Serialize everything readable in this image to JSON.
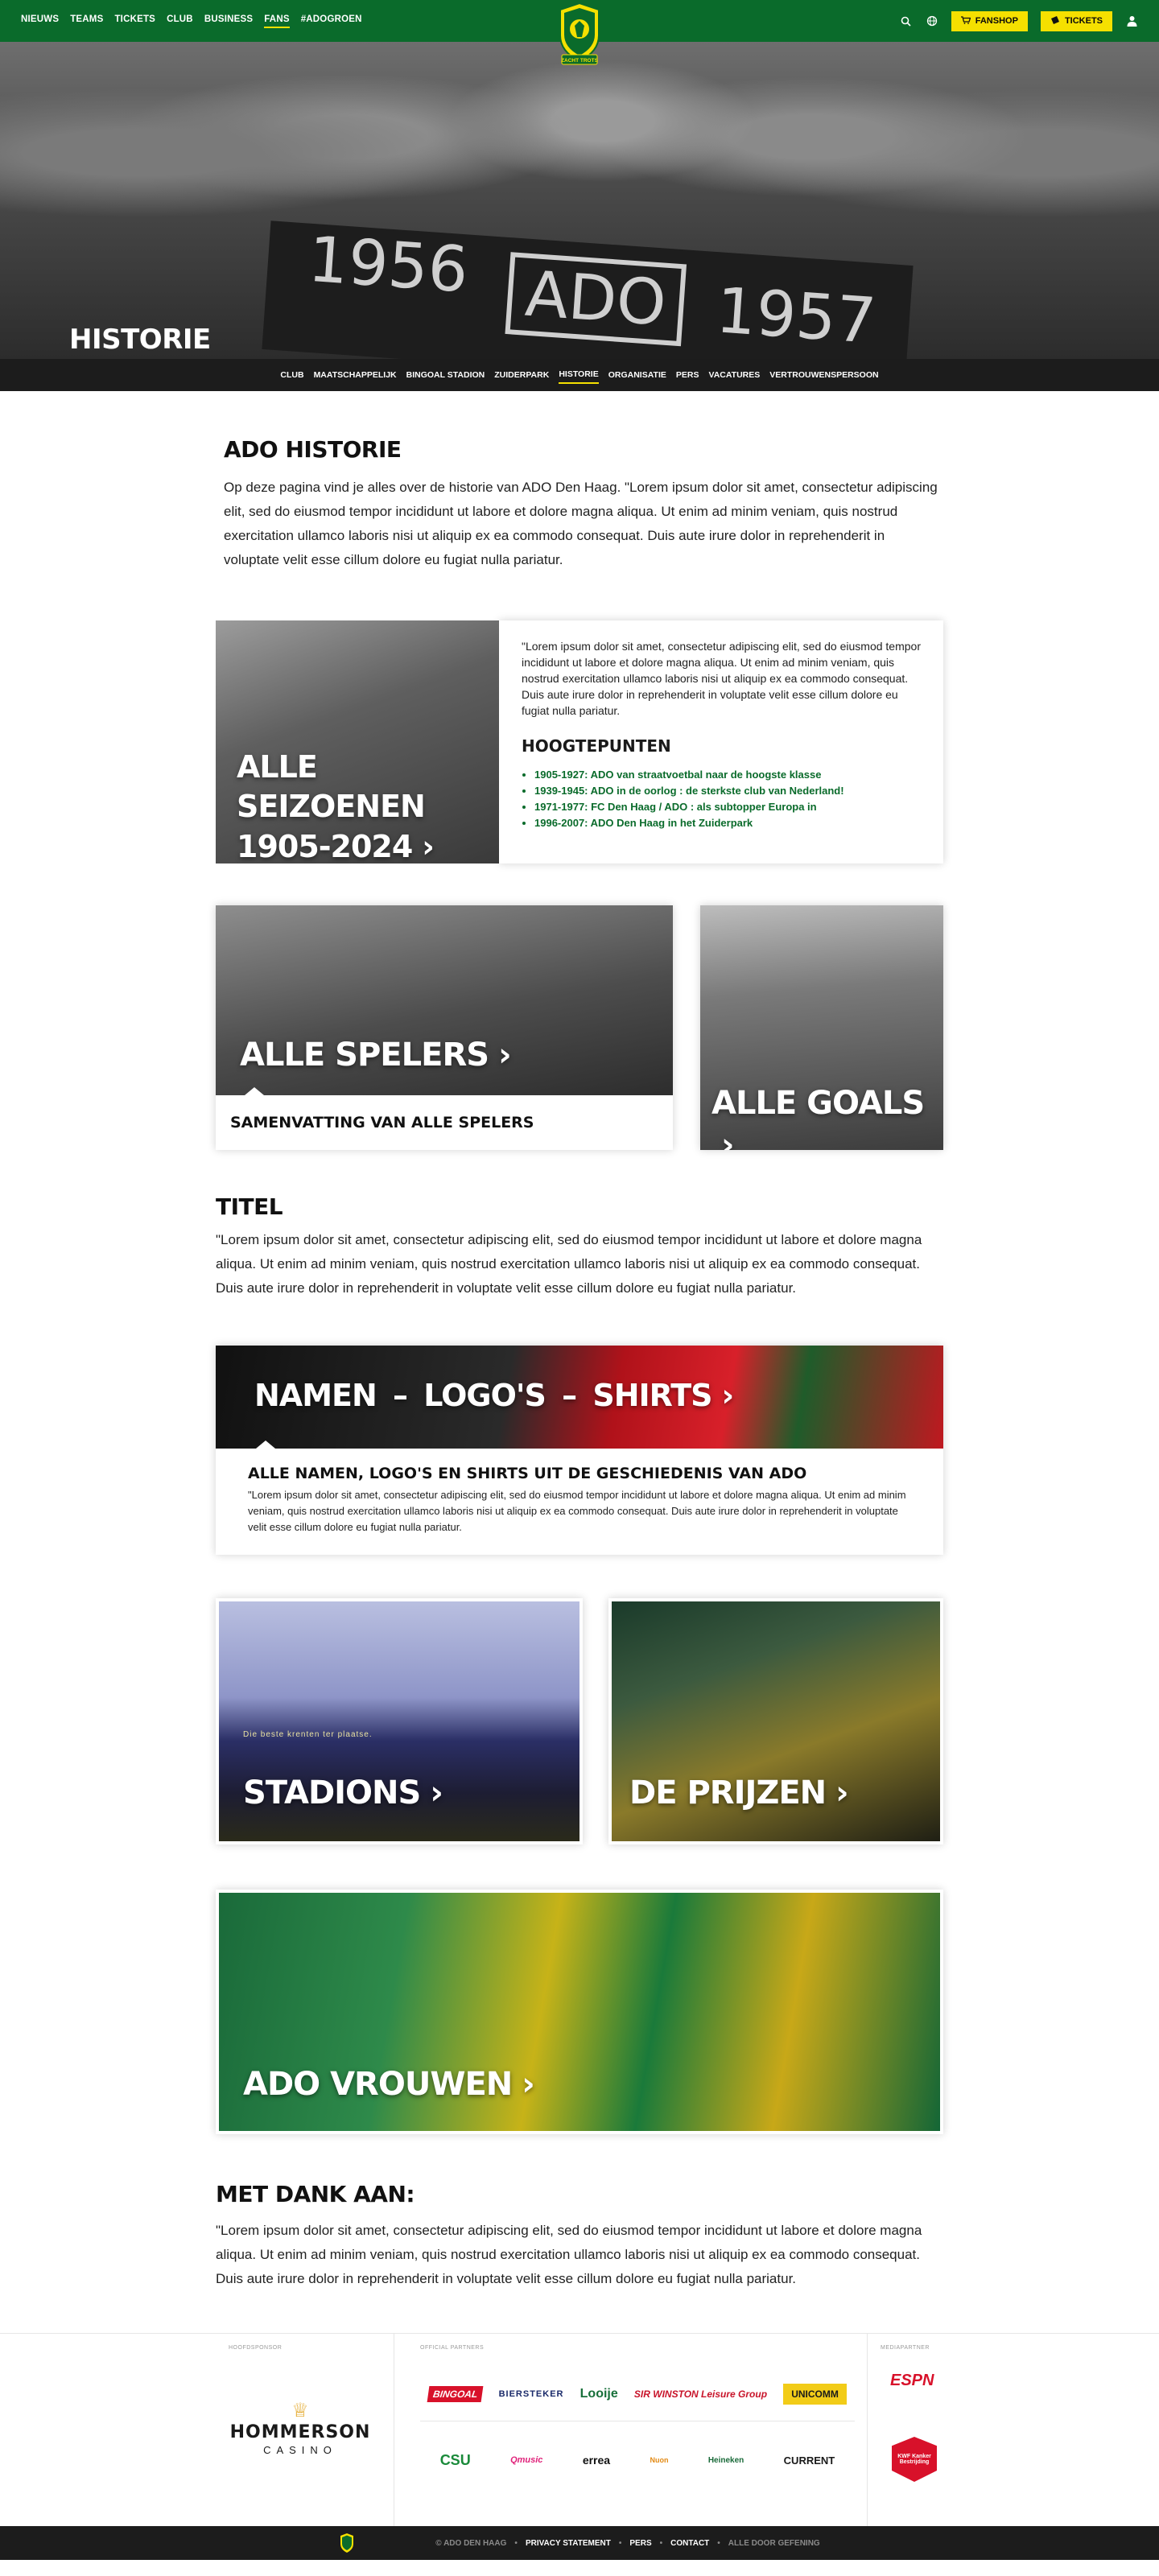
{
  "nav": {
    "items": [
      {
        "label": "NIEUWS",
        "active": false
      },
      {
        "label": "TEAMS",
        "active": false
      },
      {
        "label": "TICKETS",
        "active": false
      },
      {
        "label": "CLUB",
        "active": false
      },
      {
        "label": "BUSINESS",
        "active": false
      },
      {
        "label": "FANS",
        "active": true
      },
      {
        "label": "#ADOGROEN",
        "active": false
      }
    ],
    "crest_text": "ZACHT TROTS",
    "fanshop": "FANSHOP",
    "tickets": "TICKETS",
    "icons": [
      "search-icon",
      "globe-icon",
      "user-icon"
    ],
    "brand_green": "#0a6b2b",
    "accent_yellow": "#f5e000"
  },
  "hero": {
    "title": "HISTORIE",
    "banner_left": "1956",
    "banner_mid": "ADO",
    "banner_right": "1957"
  },
  "subnav": {
    "items": [
      {
        "label": "CLUB",
        "active": false
      },
      {
        "label": "MAATSCHAPPELIJK",
        "active": false
      },
      {
        "label": "BINGOAL STADION",
        "active": false
      },
      {
        "label": "ZUIDERPARK",
        "active": false
      },
      {
        "label": "HISTORIE",
        "active": true
      },
      {
        "label": "ORGANISATIE",
        "active": false
      },
      {
        "label": "PERS",
        "active": false
      },
      {
        "label": "VACATURES",
        "active": false
      },
      {
        "label": "VERTROUWENSPERSOON",
        "active": false
      }
    ]
  },
  "intro": {
    "title": "ADO HISTORIE",
    "text": "Op deze pagina vind je alles over de historie van ADO Den Haag. \"Lorem ipsum dolor sit amet, consectetur adipiscing elit, sed do eiusmod tempor incididunt ut labore et dolore magna aliqua. Ut enim ad minim veniam, quis nostrud exercitation ullamco laboris nisi ut aliquip ex ea commodo consequat. Duis aute irure dolor in reprehenderit in voluptate velit esse cillum dolore eu fugiat nulla pariatur."
  },
  "seasons": {
    "title_line1": "ALLE SEIZOENEN",
    "title_line2": "1905-2024",
    "card_text": "\"Lorem ipsum dolor sit amet, consectetur adipiscing elit, sed do eiusmod tempor incididunt ut labore et dolore magna aliqua. Ut enim ad minim veniam, quis nostrud exercitation ullamco laboris nisi ut aliquip ex ea commodo consequat. Duis aute irure dolor in reprehenderit in voluptate velit esse cillum dolore eu fugiat nulla pariatur.",
    "highlights_title": "HOOGTEPUNTEN",
    "highlights": [
      "1905-1927: ADO  van straatvoetbal naar de hoogste klasse",
      "1939-1945: ADO in de oorlog : de sterkste club van Nederland!",
      "1971-1977:  FC Den Haag / ADO : als subtopper Europa in",
      "1996-2007: ADO Den Haag in het Zuiderpark"
    ]
  },
  "players": {
    "title": "ALLE SPELERS",
    "caption": "SAMENVATTING VAN ALLE SPELERS"
  },
  "goals": {
    "title": "ALLE GOALS"
  },
  "titel": {
    "title": "TITEL",
    "text": "\"Lorem ipsum dolor sit amet, consectetur adipiscing elit, sed do eiusmod tempor incididunt ut labore et dolore magna aliqua. Ut enim ad minim veniam, quis nostrud exercitation ullamco laboris nisi ut aliquip ex ea commodo consequat. Duis aute irure dolor in reprehenderit in voluptate velit esse cillum dolore eu fugiat nulla pariatur."
  },
  "names": {
    "title": "NAMEN  –  LOGO'S  –  SHIRTS",
    "heading": "ALLE NAMEN, LOGO'S EN SHIRTS UIT DE GESCHIEDENIS VAN ADO",
    "text": "\"Lorem ipsum dolor sit amet, consectetur adipiscing elit, sed do eiusmod tempor incididunt ut labore et dolore magna aliqua. Ut enim ad minim veniam, quis nostrud exercitation ullamco laboris nisi ut aliquip ex ea commodo consequat. Duis aute irure dolor in reprehenderit in voluptate velit esse cillum dolore eu fugiat nulla pariatur."
  },
  "stadions": {
    "title": "STADIONS",
    "banner_text": "Die beste krenten ter plaatse."
  },
  "prijzen": {
    "title": "DE PRIJZEN"
  },
  "vrouwen": {
    "title": "ADO VROUWEN"
  },
  "dank": {
    "title": "MET DANK AAN:",
    "text": "\"Lorem ipsum dolor sit amet, consectetur adipiscing elit, sed do eiusmod tempor incididunt ut labore et dolore magna aliqua. Ut enim ad minim veniam, quis nostrud exercitation ullamco laboris nisi ut aliquip ex ea commodo consequat. Duis aute irure dolor in reprehenderit in voluptate velit esse cillum dolore eu fugiat nulla pariatur."
  },
  "partners": {
    "main_label": "HOOFDSPONSOR",
    "official_label": "OFFICIAL PARTNERS",
    "media_label": "MEDIAPARTNER",
    "main": {
      "line1": "HOMMERSON",
      "line2": "CASINO"
    },
    "row1": [
      "BINGOAL",
      "BIERSTEKER",
      "Looije",
      "SIR WINSTON Leisure Group",
      "UNICOMM"
    ],
    "row2": [
      "CSU",
      "Qmusic",
      "errea",
      "Nuon",
      "Heineken",
      "CURRENT"
    ],
    "media": [
      "ESPN",
      "KWF Kanker Bestrijding"
    ]
  },
  "footer": {
    "copyright": "© ADO DEN HAAG",
    "privacy": "PRIVACY STATEMENT",
    "pers": "PERS",
    "contact": "CONTACT",
    "credit": "ALLE DOOR GEFENING"
  }
}
